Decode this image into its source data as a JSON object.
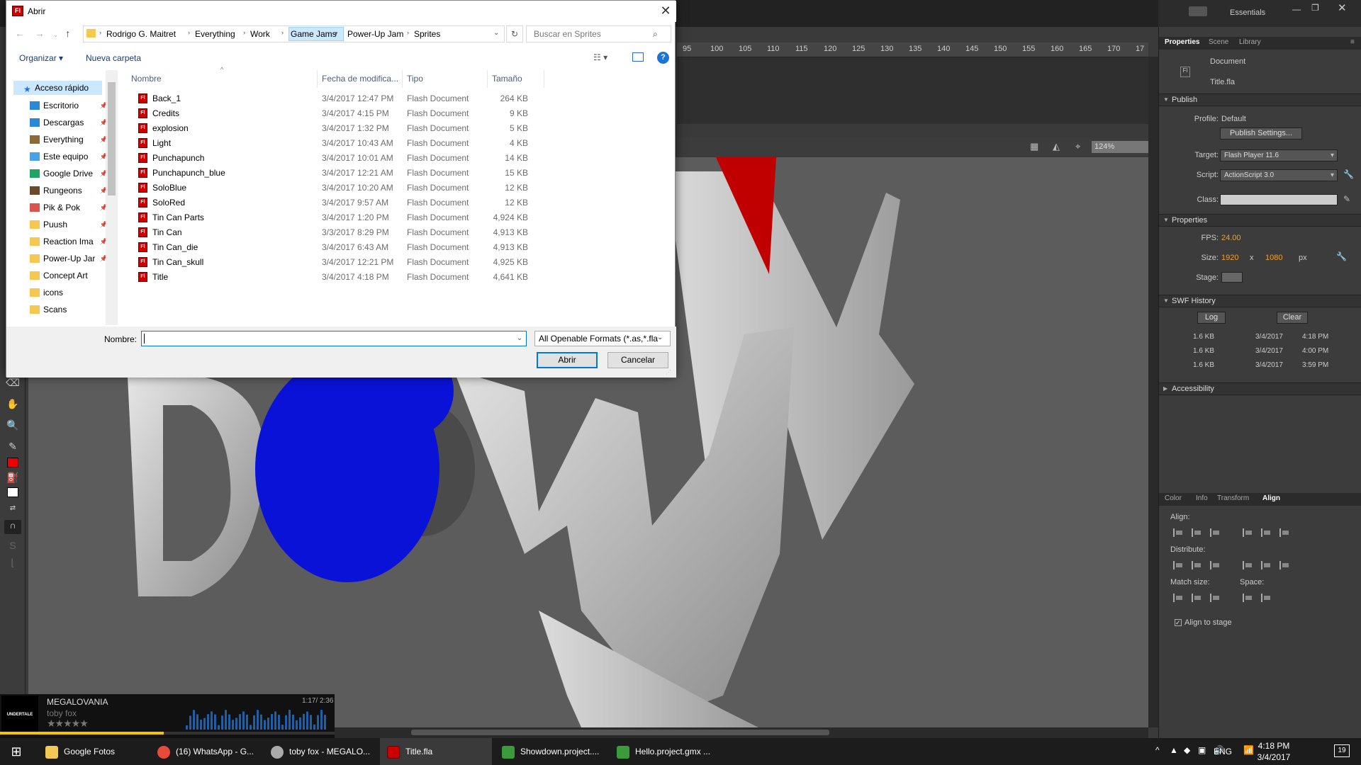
{
  "dialog": {
    "title": "Abrir",
    "breadcrumb": [
      "Rodrigo G. Maitret",
      "Everything",
      "Work",
      "Game Jams",
      "Power-Up Jam",
      "Sprites"
    ],
    "search_placeholder": "Buscar en Sprites",
    "toolbar": {
      "organize": "Organizar",
      "new_folder": "Nueva carpeta"
    },
    "nav": {
      "quick_access": "Acceso rápido",
      "items": [
        "Escritorio",
        "Descargas",
        "Everything",
        "Este equipo",
        "Google Drive",
        "Rungeons",
        "Pik & Pok",
        "Puush",
        "Reaction Ima",
        "Power-Up Jar",
        "Concept Art",
        "icons",
        "Scans"
      ]
    },
    "columns": {
      "name": "Nombre",
      "date": "Fecha de modifica...",
      "type": "Tipo",
      "size": "Tamaño"
    },
    "files": [
      {
        "name": "Back_1",
        "date": "3/4/2017 12:47 PM",
        "type": "Flash Document",
        "size": "264 KB"
      },
      {
        "name": "Credits",
        "date": "3/4/2017 4:15 PM",
        "type": "Flash Document",
        "size": "9 KB"
      },
      {
        "name": "explosion",
        "date": "3/4/2017 1:32 PM",
        "type": "Flash Document",
        "size": "5 KB"
      },
      {
        "name": "Light",
        "date": "3/4/2017 10:43 AM",
        "type": "Flash Document",
        "size": "4 KB"
      },
      {
        "name": "Punchapunch",
        "date": "3/4/2017 10:01 AM",
        "type": "Flash Document",
        "size": "14 KB"
      },
      {
        "name": "Punchapunch_blue",
        "date": "3/4/2017 12:21 AM",
        "type": "Flash Document",
        "size": "15 KB"
      },
      {
        "name": "SoloBlue",
        "date": "3/4/2017 10:20 AM",
        "type": "Flash Document",
        "size": "12 KB"
      },
      {
        "name": "SoloRed",
        "date": "3/4/2017 9:57 AM",
        "type": "Flash Document",
        "size": "12 KB"
      },
      {
        "name": "Tin Can Parts",
        "date": "3/4/2017 1:20 PM",
        "type": "Flash Document",
        "size": "4,924 KB"
      },
      {
        "name": "Tin Can",
        "date": "3/3/2017 8:29 PM",
        "type": "Flash Document",
        "size": "4,913 KB"
      },
      {
        "name": "Tin Can_die",
        "date": "3/4/2017 6:43 AM",
        "type": "Flash Document",
        "size": "4,913 KB"
      },
      {
        "name": "Tin Can_skull",
        "date": "3/4/2017 12:21 PM",
        "type": "Flash Document",
        "size": "4,925 KB"
      },
      {
        "name": "Title",
        "date": "3/4/2017 4:18 PM",
        "type": "Flash Document",
        "size": "4,641 KB"
      }
    ],
    "filename_label": "Nombre:",
    "filename_value": "",
    "filetype": "All Openable Formats (*.as,*.fla",
    "open_button": "Abrir",
    "cancel_button": "Cancelar"
  },
  "workspace": {
    "essentials": "Essentials",
    "ruler_ticks": [
      "95",
      "100",
      "105",
      "110",
      "115",
      "120",
      "125",
      "130",
      "135",
      "140",
      "145",
      "150",
      "155",
      "160",
      "165",
      "170",
      "17"
    ],
    "zoom": "124%"
  },
  "panel": {
    "tabs": [
      "Properties",
      "Scene",
      "Library"
    ],
    "doc_type": "Document",
    "doc_name": "Title.fla",
    "publish": {
      "heading": "Publish",
      "profile_label": "Profile:",
      "profile": "Default",
      "settings_button": "Publish Settings...",
      "target_label": "Target:",
      "target": "Flash Player 11.6",
      "script_label": "Script:",
      "script": "ActionScript 3.0",
      "class_label": "Class:"
    },
    "properties": {
      "heading": "Properties",
      "fps_label": "FPS:",
      "fps": "24.00",
      "size_label": "Size:",
      "width": "1920",
      "x": "x",
      "height": "1080",
      "unit": "px",
      "stage_label": "Stage:"
    },
    "swf_history": {
      "heading": "SWF History",
      "log_button": "Log",
      "clear_button": "Clear",
      "entries": [
        {
          "size": "1.6 KB",
          "date": "3/4/2017",
          "time": "4:18 PM"
        },
        {
          "size": "1.6 KB",
          "date": "3/4/2017",
          "time": "4:00 PM"
        },
        {
          "size": "1.6 KB",
          "date": "3/4/2017",
          "time": "3:59 PM"
        }
      ]
    },
    "accessibility": "Accessibility",
    "bottom_tabs": [
      "Color",
      "Info",
      "Transform",
      "Align"
    ],
    "align": {
      "align_label": "Align:",
      "distribute_label": "Distribute:",
      "match_label": "Match size:",
      "space_label": "Space:",
      "align_to_stage": "Align to stage"
    }
  },
  "music": {
    "art_text": "UNDERTALE",
    "title": "MEGALOVANIA",
    "artist": "toby fox",
    "stars": "★★★★★",
    "time": "1:17/ 2:36",
    "progress": 0.49
  },
  "taskbar": {
    "items": [
      "Google Fotos",
      "(16) WhatsApp - G...",
      "toby fox - MEGALO...",
      "Title.fla",
      "Showdown.project....",
      "Hello.project.gmx ..."
    ],
    "lang": "ENG",
    "time": "4:18 PM",
    "date": "3/4/2017",
    "notifications": "19"
  },
  "colors": {
    "accent": "#0078d7",
    "flash_red": "#cc0000",
    "stage_gray": "#5c5c5c",
    "blue_circle": "#0a12d8"
  }
}
